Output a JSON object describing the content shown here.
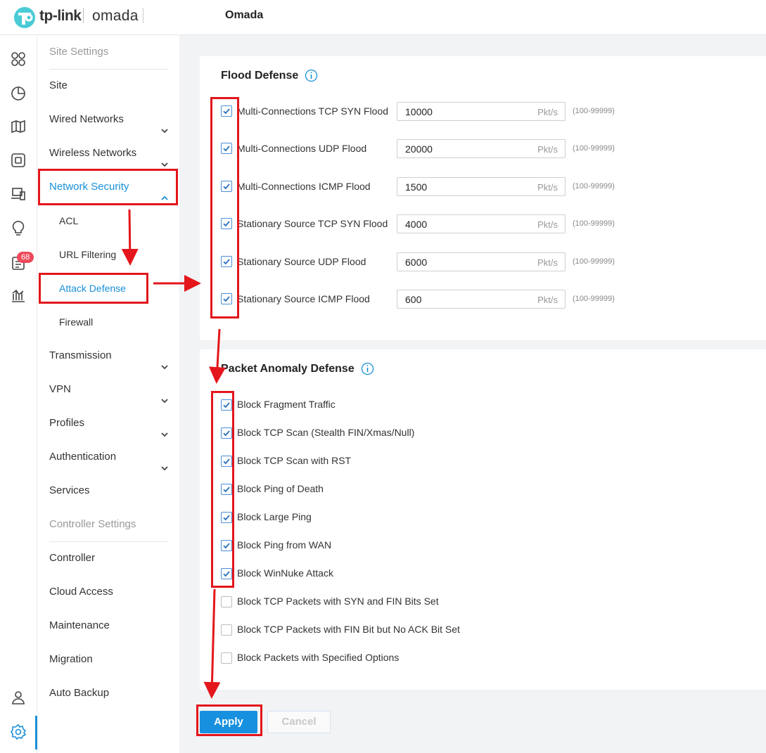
{
  "header": {
    "brand": "tp-link",
    "product": "omada",
    "title": "Omada"
  },
  "rail": {
    "icons": [
      "dashboard-icon",
      "statistics-icon",
      "map-icon",
      "devices-icon",
      "clients-icon",
      "insights-icon",
      "logs-icon",
      "reports-icon",
      "account-icon",
      "settings-icon"
    ],
    "logs_badge": "68"
  },
  "menu": {
    "site_settings": "Site Settings",
    "site": "Site",
    "wired_networks": "Wired Networks",
    "wireless_networks": "Wireless Networks",
    "network_security": "Network Security",
    "acl": "ACL",
    "url_filtering": "URL Filtering",
    "attack_defense": "Attack Defense",
    "firewall": "Firewall",
    "transmission": "Transmission",
    "vpn": "VPN",
    "profiles": "Profiles",
    "authentication": "Authentication",
    "services": "Services",
    "controller_settings": "Controller Settings",
    "controller": "Controller",
    "cloud_access": "Cloud Access",
    "maintenance": "Maintenance",
    "migration": "Migration",
    "auto_backup": "Auto Backup"
  },
  "flood": {
    "title": "Flood Defense",
    "unit": "Pkt/s",
    "range": "(100-99999)",
    "rows": [
      {
        "label": "Multi-Connections TCP SYN Flood",
        "value": "10000",
        "checked": true
      },
      {
        "label": "Multi-Connections UDP Flood",
        "value": "20000",
        "checked": true
      },
      {
        "label": "Multi-Connections ICMP Flood",
        "value": "1500",
        "checked": true
      },
      {
        "label": "Stationary Source TCP SYN Flood",
        "value": "4000",
        "checked": true
      },
      {
        "label": "Stationary Source UDP Flood",
        "value": "6000",
        "checked": true
      },
      {
        "label": "Stationary Source ICMP Flood",
        "value": "600",
        "checked": true
      }
    ]
  },
  "anomaly": {
    "title": "Packet Anomaly Defense",
    "rows": [
      {
        "label": "Block Fragment Traffic",
        "checked": true
      },
      {
        "label": "Block TCP Scan (Stealth FIN/Xmas/Null)",
        "checked": true
      },
      {
        "label": "Block TCP Scan with RST",
        "checked": true
      },
      {
        "label": "Block Ping of Death",
        "checked": true
      },
      {
        "label": "Block Large Ping",
        "checked": true
      },
      {
        "label": "Block Ping from WAN",
        "checked": true
      },
      {
        "label": "Block WinNuke Attack",
        "checked": true
      },
      {
        "label": "Block TCP Packets with SYN and FIN Bits Set",
        "checked": false
      },
      {
        "label": "Block TCP Packets with FIN Bit but No ACK Bit Set",
        "checked": false
      },
      {
        "label": "Block Packets with Specified Options",
        "checked": false
      }
    ]
  },
  "actions": {
    "apply": "Apply",
    "cancel": "Cancel"
  },
  "colors": {
    "accent": "#1890d8",
    "annotation": "#e3161b",
    "badge": "#ef4a5b"
  }
}
